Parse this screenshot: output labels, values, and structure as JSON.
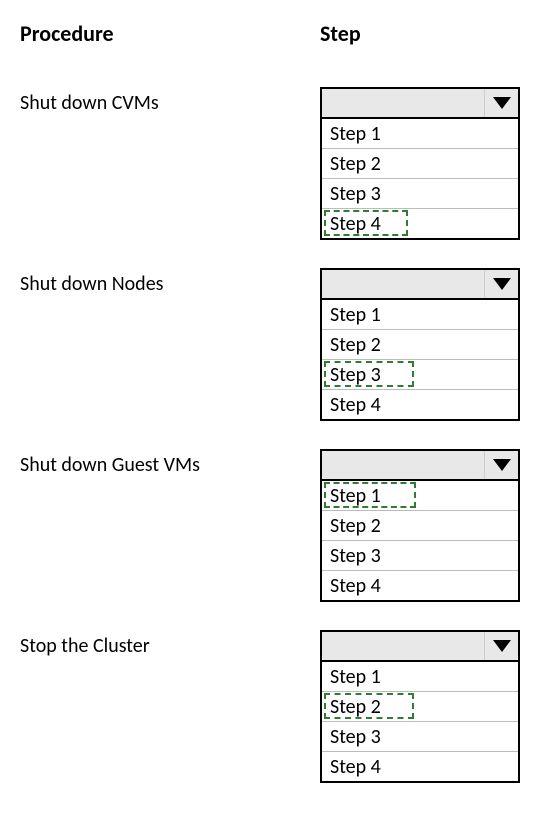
{
  "headers": {
    "procedure": "Procedure",
    "step": "Step"
  },
  "rows": [
    {
      "procedure": "Shut  down CVMs",
      "options": [
        "Step 1",
        "Step 2",
        "Step 3",
        "Step 4"
      ],
      "highlight_index": 3,
      "highlight_width": 84
    },
    {
      "procedure": "Shut down Nodes",
      "options": [
        "Step 1",
        "Step 2",
        "Step 3",
        "Step 4"
      ],
      "highlight_index": 2,
      "highlight_width": 90
    },
    {
      "procedure": "Shut down Guest VMs",
      "options": [
        "Step 1",
        "Step 2",
        "Step 3",
        "Step 4"
      ],
      "highlight_index": 0,
      "highlight_width": 92
    },
    {
      "procedure": "Stop the Cluster",
      "options": [
        "Step 1",
        "Step 2",
        "Step 3",
        "Step 4"
      ],
      "highlight_index": 1,
      "highlight_width": 90
    }
  ]
}
